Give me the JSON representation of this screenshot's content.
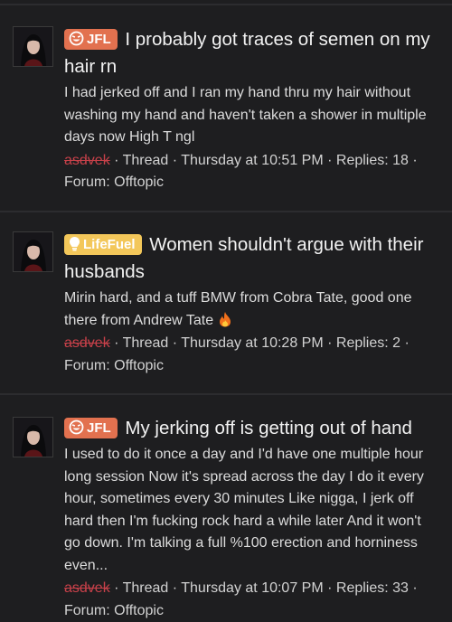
{
  "threads": [
    {
      "badge": "JFL",
      "title": "I probably got traces of semen on my hair rn",
      "snippet": "I had jerked off and I ran my hand thru my hair without washing my hand and haven't taken a shower in multiple days now High T ngl",
      "author": "asdvek",
      "meta": " · Thread · Thursday at 10:51 PM · Replies: 18 · ",
      "forum": "Forum: Offtopic"
    },
    {
      "badge": "LifeFuel",
      "title": "Women shouldn't argue with their husbands",
      "snippet": "Mirin hard, and a tuff BMW from Cobra Tate, good one there from Andrew Tate",
      "author": "asdvek",
      "meta": " · Thread · Thursday at 10:28 PM · Replies: 2 · ",
      "forum": "Forum: Offtopic"
    },
    {
      "badge": "JFL",
      "title": "My jerking off is getting out of hand",
      "snippet": "I used to do it once a day and I'd have one multiple hour long session Now it's spread across the day I do it every hour, sometimes every 30 minutes Like nigga, I jerk off hard then I'm fucking rock hard a while later And it won't go down. I'm talking a full %100 erection and horniness even...",
      "author": "asdvek",
      "meta": " · Thread · Thursday at 10:07 PM · Replies: 33 · ",
      "forum": "Forum: Offtopic"
    }
  ],
  "colors": {
    "background": "#1e1e20",
    "jfl_badge": "#e2714f",
    "lifefuel_badge": "#f3c75a",
    "author": "#c9414a"
  },
  "icons": {
    "jfl": "crying-laughing-face-icon",
    "lifefuel": "lightbulb-icon",
    "snippet_emoji": "fire-emoji"
  }
}
